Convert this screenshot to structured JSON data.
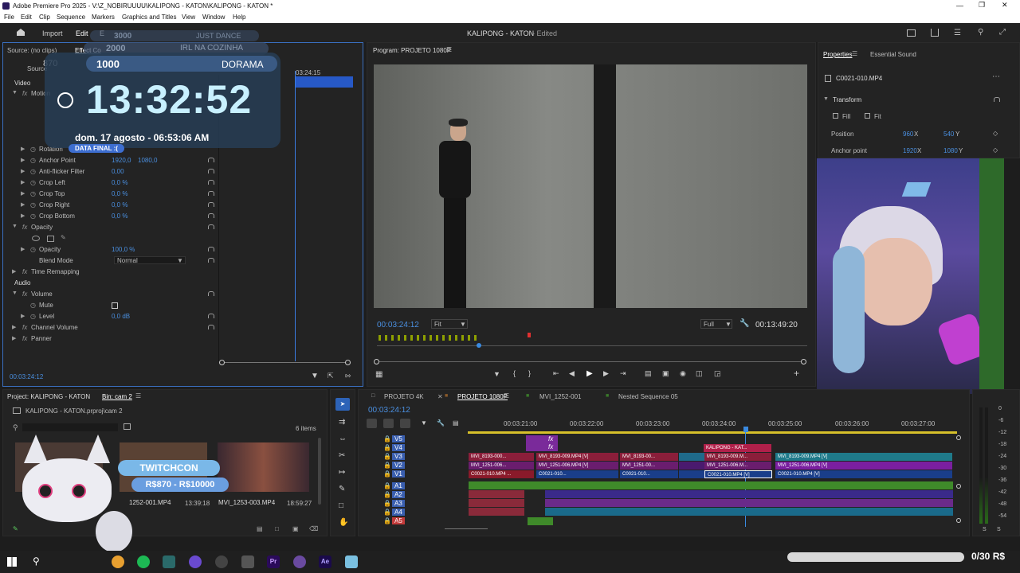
{
  "window": {
    "title": "Adobe Premiere Pro 2025 - V:\\Z_NOBIRUUUU\\KALIPONG - KATON\\KALIPONG - KATON *"
  },
  "menu": [
    "File",
    "Edit",
    "Clip",
    "Sequence",
    "Markers",
    "Graphics and Titles",
    "View",
    "Window",
    "Help"
  ],
  "header": {
    "tabs": [
      "Import",
      "Edit",
      "E"
    ],
    "project_title": "KALIPONG - KATON",
    "edit_status": "- Edited"
  },
  "source_panel": {
    "title": "Source: (no clips)",
    "tab_effect": "Effect Co",
    "tab_source": "Source",
    "timecode": "00:03:24:12",
    "ruler_time": "03:24:15",
    "video_label": "Video",
    "audio_label": "Audio",
    "rows": [
      {
        "label": "Motion",
        "value": "",
        "value2": ""
      },
      {
        "label": "Rotation",
        "value": "",
        "value2": ""
      },
      {
        "label": "Anchor Point",
        "value": "1920,0",
        "value2": "1080,0"
      },
      {
        "label": "Anti-flicker Filter",
        "value": "0,00",
        "value2": ""
      },
      {
        "label": "Crop Left",
        "value": "0,0 %",
        "value2": ""
      },
      {
        "label": "Crop Top",
        "value": "0,0 %",
        "value2": ""
      },
      {
        "label": "Crop Right",
        "value": "0,0 %",
        "value2": ""
      },
      {
        "label": "Crop Bottom",
        "value": "0,0 %",
        "value2": ""
      },
      {
        "label": "Opacity",
        "value": "",
        "value2": ""
      },
      {
        "label": "Opacity",
        "value": "100,0 %",
        "value2": ""
      },
      {
        "label": "Blend Mode",
        "value": "Normal",
        "value2": ""
      },
      {
        "label": "Time Remapping",
        "value": "",
        "value2": ""
      },
      {
        "label": "Volume",
        "value": "",
        "value2": ""
      },
      {
        "label": "Mute",
        "value": "",
        "value2": ""
      },
      {
        "label": "Level",
        "value": "0,0 dB",
        "value2": ""
      },
      {
        "label": "Channel Volume",
        "value": "",
        "value2": ""
      },
      {
        "label": "Panner",
        "value": "",
        "value2": ""
      }
    ]
  },
  "overlay": {
    "goal_3000": "3000",
    "goal_just_dance": "JUST DANCE",
    "goal_2000": "2000",
    "goal_irl": "IRL NA COZINHA",
    "goal_870": "870",
    "goal_1000": "1000",
    "goal_dorama": "DORAMA",
    "clock": "13:32:52",
    "date": "dom. 17 agosto - 06:53:06 AM",
    "badge": "DATA FINAL :(",
    "twitchcon": "TWITCHCON",
    "price": "R$870 - R$10000",
    "counter": "0/30 R$"
  },
  "program": {
    "title": "Program: PROJETO 1080P",
    "timecode": "00:03:24:12",
    "fit": "Fit",
    "quality": "Full",
    "duration": "00:13:49:20"
  },
  "properties": {
    "tab1": "Properties",
    "tab2": "Essential Sound",
    "clip": "C0021-010.MP4",
    "section": "Transform",
    "fill": "Fill",
    "fit": "Fit",
    "position_label": "Position",
    "pos_x": "960",
    "pos_y": "540",
    "anchor_label": "Anchor point",
    "anc_x": "1920",
    "anc_y": "1080",
    "x": "X",
    "y": "Y"
  },
  "project": {
    "title": "Project: KALIPONG - KATON",
    "bin": "Bin: cam 2",
    "file": "KALIPONG - KATON.prproj\\cam 2",
    "items": "6 items",
    "clips": [
      {
        "name": "1252-001.MP4",
        "dur": "13:39:18"
      },
      {
        "name": "MVI_1253-003.MP4",
        "dur": "18:59:27"
      }
    ]
  },
  "timeline": {
    "tabs": [
      "PROJETO 4K",
      "PROJETO 1080P",
      "MVI_1252-001",
      "Nested Sequence 05"
    ],
    "timecode": "00:03:24:12",
    "ruler": [
      "00:03:21:00",
      "00:03:22:00",
      "00:03:23:00",
      "00:03:24:00",
      "00:03:25:00",
      "00:03:26:00",
      "00:03:27:00"
    ],
    "video_tracks": [
      "V5",
      "V4",
      "V3",
      "V2",
      "V1"
    ],
    "audio_tracks": [
      "A1",
      "A2",
      "A3",
      "A4",
      "A5"
    ],
    "clips_v3": [
      "MVI_8193-000...",
      "MVI_8193-009.MP4 [V]",
      "MVI_8193-00...",
      "MVI_8193-009.M...",
      "MVI_8193-009.MP4 [V]"
    ],
    "clips_v2": [
      "MVI_1251-006...",
      "MVI_1251-006.MP4 [V]",
      "MVI_1251-00...",
      "MVI_1251-006.M...",
      "MVI_1251-006.MP4 [V]"
    ],
    "clips_v1": [
      "C0021-010.MP4 ...",
      "C0021-010...",
      "C0021-010...",
      "C0021-010.MP4 [V]",
      "C0021-010.MP4 [V]"
    ],
    "v4_label": "KALIPONG - KAT...",
    "fx": "fx",
    "meter": [
      "0",
      "-6",
      "-12",
      "-18",
      "-24",
      "-30",
      "-36",
      "-42",
      "-48",
      "-54"
    ],
    "meter_s": "S"
  },
  "taskbar": [
    "Pr",
    "Ae"
  ],
  "colors": {
    "accent": "#2d8ceb",
    "blue_value": "#4a8fe0",
    "v3": "#8b1e3a",
    "v2": "#6a1d6e",
    "v1": "#8a1a2a",
    "audio_green": "#3f8a2a"
  }
}
